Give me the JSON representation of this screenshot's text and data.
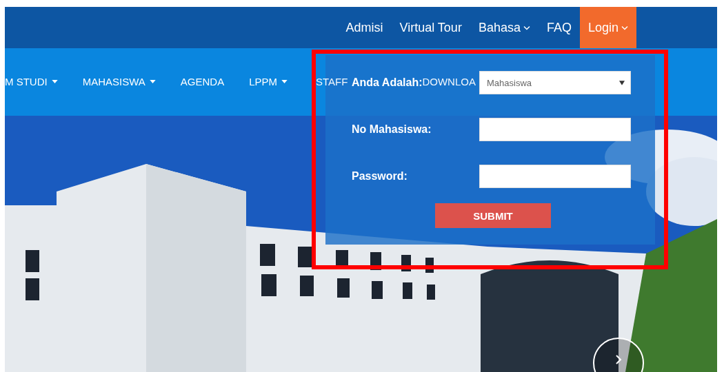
{
  "top_nav": [
    {
      "label": "Admisi",
      "kind": "link",
      "selected": false
    },
    {
      "label": "Virtual Tour",
      "kind": "link",
      "selected": false
    },
    {
      "label": "Bahasa",
      "kind": "dropdown",
      "selected": false
    },
    {
      "label": "FAQ",
      "kind": "link",
      "selected": false
    },
    {
      "label": "Login",
      "kind": "dropdown",
      "selected": true
    }
  ],
  "main_nav": [
    {
      "label": "M STUDI",
      "kind": "dropdown"
    },
    {
      "label": "MAHASISWA",
      "kind": "dropdown"
    },
    {
      "label": "AGENDA",
      "kind": "link"
    },
    {
      "label": "LPPM",
      "kind": "dropdown"
    },
    {
      "label": "STAFF",
      "kind": "link"
    },
    {
      "label": "DOWNLOA",
      "kind": "link"
    }
  ],
  "login_form": {
    "fields": [
      {
        "label": "Anda Adalah:",
        "kind": "select",
        "value": "Mahasiswa"
      },
      {
        "label": "No Mahasiswa:",
        "kind": "text"
      },
      {
        "label": "Password:",
        "kind": "password"
      }
    ],
    "submit": "SUBMIT"
  }
}
